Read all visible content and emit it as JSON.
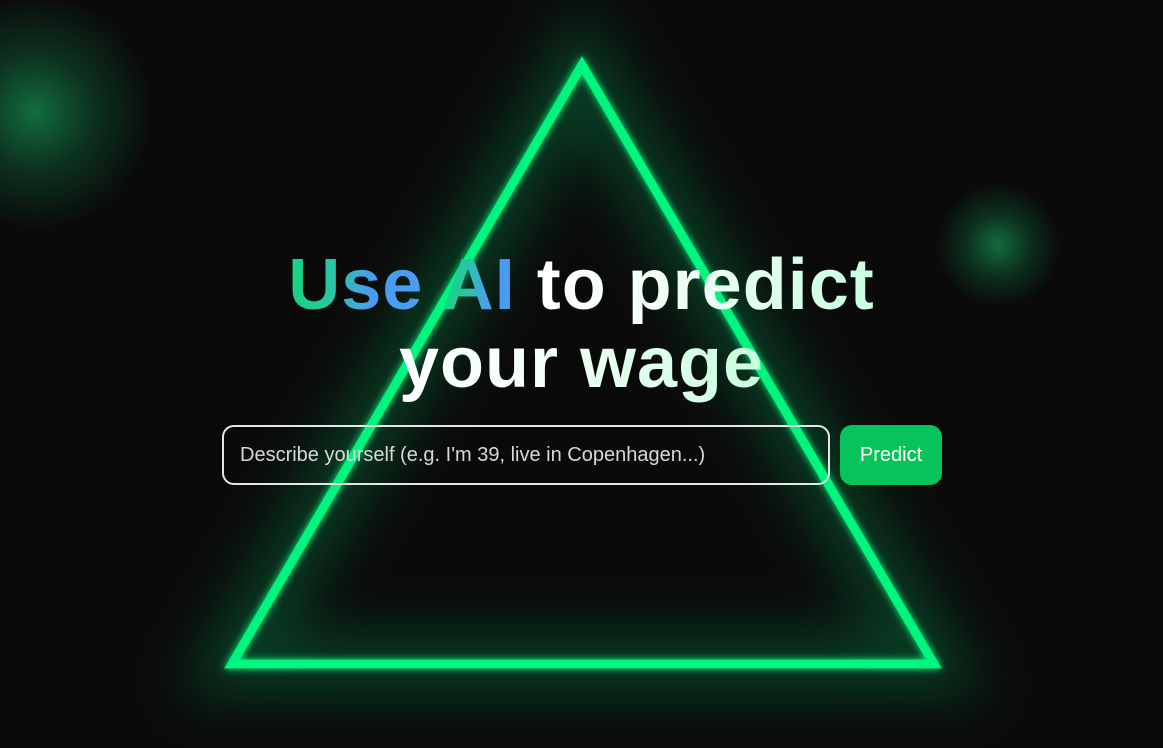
{
  "hero": {
    "headline": {
      "word_use": "Use",
      "word_ai": "AI",
      "rest_line1": "to predict",
      "line2": "your wage"
    }
  },
  "search": {
    "placeholder": "Describe yourself (e.g. I'm 39, live in Copenhagen...)",
    "value": ""
  },
  "predict_button": {
    "label": "Predict"
  },
  "colors": {
    "background": "#0a0a0a",
    "neon_green": "#05f57f",
    "button_green": "#07c45a",
    "gradient_green": "#17d47e",
    "gradient_blue": "#4a9cf0"
  },
  "decor": {
    "shape": "triangle",
    "background_orbs": [
      "orb-top-left",
      "orb-right"
    ]
  }
}
